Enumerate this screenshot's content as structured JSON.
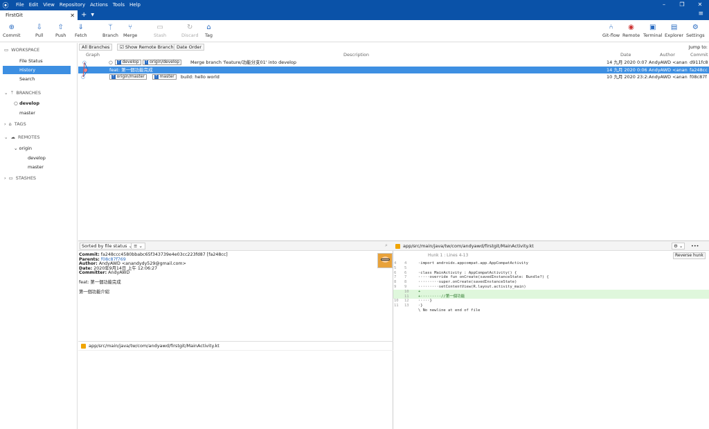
{
  "menu": {
    "items": [
      "File",
      "Edit",
      "View",
      "Repository",
      "Actions",
      "Tools",
      "Help"
    ]
  },
  "tab": {
    "title": "FirstGit"
  },
  "toolbar": {
    "left": [
      "Commit",
      "Pull",
      "Push",
      "Fetch",
      "Branch",
      "Merge",
      "Stash",
      "Discard",
      "Tag"
    ],
    "right": [
      "Git-flow",
      "Remote",
      "Terminal",
      "Explorer",
      "Settings"
    ]
  },
  "sidebar": {
    "workspace": "WORKSPACE",
    "file_status": "File Status",
    "history": "History",
    "search": "Search",
    "branches": "BRANCHES",
    "branch1": "develop",
    "branch2": "master",
    "tags": "TAGS",
    "remotes": "REMOTES",
    "origin": "origin",
    "r1": "develop",
    "r2": "master",
    "stashes": "STASHES"
  },
  "filters": {
    "branches": "All Branches",
    "remote": "Show Remote Branches",
    "order": "Date Order",
    "jump": "Jump to:"
  },
  "columns": {
    "graph": "Graph",
    "desc": "Description",
    "date": "Date",
    "author": "Author",
    "commit": "Commit"
  },
  "commits": [
    {
      "chips": [
        "develop",
        "origin/develop"
      ],
      "desc": "Merge branch 'feature/功能分支01' into develop",
      "date": "14 九月 2020 0:07",
      "author": "AndyAWD <anan",
      "hash": "d911fc8"
    },
    {
      "chips": [],
      "desc": "feat: 第一個功能完成",
      "date": "14 九月 2020 0:06",
      "author": "AndyAWD <anan",
      "hash": "fa248cc"
    },
    {
      "chips": [
        "origin/master",
        "master"
      ],
      "desc": "build: hello world",
      "date": "10 九月 2020 23:2:",
      "author": "AndyAWD <anan",
      "hash": "f08c87f"
    }
  ],
  "details": {
    "sort": "Sorted by file status",
    "commit_l": "Commit:",
    "commit_v": "fa248ccc4580bbabc65f343739e4e03cc223fd87 [fa248cc]",
    "parents_l": "Parents:",
    "parents_v": "f08c87f769",
    "author_l": "Author:",
    "author_v": "AndyAWD <anandydy529@gmail.com>",
    "date_l": "Date:",
    "date_v": "2020年9月14日 上午 12:06:27",
    "committer_l": "Committer:",
    "committer_v": "AndyAWD",
    "msg1": "feat: 第一個功能完成",
    "msg2": "第一個功能介紹",
    "file": "app/src/main/java/tw/com/andyawd/firstgit/MainActivity.kt"
  },
  "diff": {
    "file": "app/src/main/java/tw/com/andyawd/firstgit/MainActivity.kt",
    "hunk": "Hunk 1 : Lines 4-13",
    "reverse": "Reverse hunk",
    "lines": [
      {
        "o": "4",
        "n": "4",
        "t": "·import androidx.appcompat.app.AppCompatActivity",
        "add": false
      },
      {
        "o": "5",
        "n": "5",
        "t": "",
        "add": false
      },
      {
        "o": "6",
        "n": "6",
        "t": "·class MainActivity : AppCompatActivity() {",
        "add": false
      },
      {
        "o": "7",
        "n": "7",
        "t": "·····override fun onCreate(savedInstanceState: Bundle?) {",
        "add": false
      },
      {
        "o": "8",
        "n": "8",
        "t": "·········super.onCreate(savedInstanceState)",
        "add": false
      },
      {
        "o": "9",
        "n": "9",
        "t": "·········setContentView(R.layout.activity_main)",
        "add": false
      },
      {
        "o": "",
        "n": "10",
        "t": "+",
        "add": true
      },
      {
        "o": "",
        "n": "11",
        "t": "+·········//第一個功能",
        "add": true
      },
      {
        "o": "10",
        "n": "12",
        "t": "·····}",
        "add": false
      },
      {
        "o": "11",
        "n": "13",
        "t": "·}",
        "add": false
      },
      {
        "o": "",
        "n": "",
        "t": "\\ No newline at end of file",
        "add": false
      }
    ]
  }
}
